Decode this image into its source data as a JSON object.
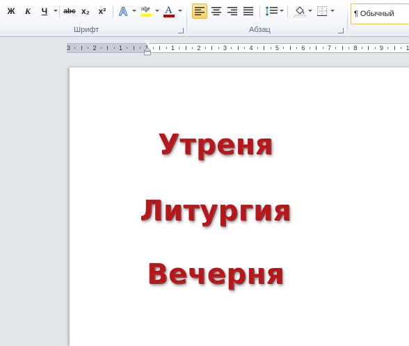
{
  "ribbon": {
    "font_buttons": {
      "bold": "Ж",
      "italic": "К",
      "underline": "Ч",
      "strikethrough": "abc",
      "subscript": "x₂",
      "superscript": "x²"
    },
    "highlight_label": "ab",
    "font_color_label": "A",
    "groups": {
      "font": "Шрифт",
      "paragraph": "Абзац"
    },
    "style_gallery": {
      "mark": "¶",
      "normal_label": "Обычный"
    },
    "colors": {
      "highlight": "#ffff00",
      "font_color": "#c00000",
      "text_effects": "#4f81bd",
      "active_button": "#f9d36b"
    }
  },
  "ruler": {
    "numbers": [
      "3",
      "2",
      "1",
      "1",
      "1",
      "2",
      "3",
      "4",
      "5",
      "6",
      "7",
      "8",
      "9",
      "1"
    ]
  },
  "document": {
    "lines": [
      "Утреня",
      "Литургия",
      "Вечерня"
    ],
    "text_color": "#b3191c"
  },
  "icons": [
    "text-effects-icon",
    "highlight-icon",
    "font-color-icon",
    "align-left-icon",
    "align-center-icon",
    "align-right-icon",
    "justify-icon",
    "line-spacing-icon",
    "shading-icon",
    "borders-icon",
    "dialog-launcher-icon"
  ]
}
